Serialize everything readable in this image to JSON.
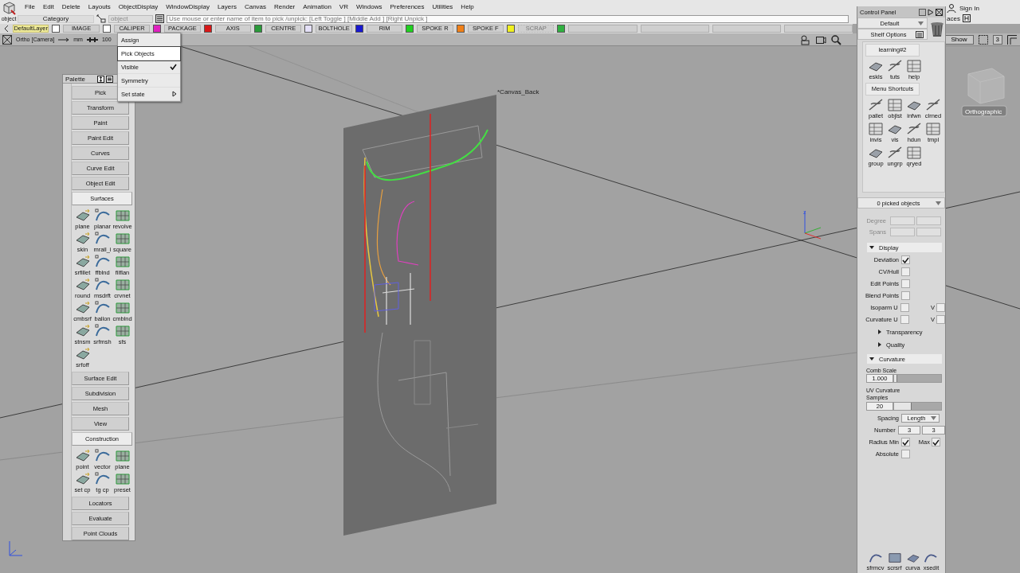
{
  "menu_bar": {
    "app_label": "object",
    "items": [
      "File",
      "Edit",
      "Delete",
      "Layouts",
      "ObjectDisplay",
      "WindowDisplay",
      "Layers",
      "Canvas",
      "Render",
      "Animation",
      "VR",
      "Windows",
      "Preferences",
      "Utilities",
      "Help"
    ],
    "sign_in": "Sign In",
    "shelf_fragment": "aces"
  },
  "pick_bar": {
    "category": "Category",
    "object_placeholder": "object",
    "prompt": "Use mouse or enter name of item to pick /unpick: [Left Toggle ] [Middle Add ] [Right Unpick ]"
  },
  "layers": [
    {
      "name": "DefaultLayer",
      "selected": true,
      "color": "#ffffff"
    },
    {
      "name": "IMAGE",
      "selected": false,
      "color": "#ffffff"
    },
    {
      "name": "CALIPER",
      "selected": false,
      "color": "#e020c0"
    },
    {
      "name": "PACKAGE",
      "selected": false,
      "color": "#d81818"
    },
    {
      "name": "AXIS",
      "selected": false,
      "color": "#2a9a3a"
    },
    {
      "name": "CENTRE",
      "selected": false,
      "color": "#e4e0f8"
    },
    {
      "name": "BOLTHOLE",
      "selected": false,
      "color": "#1818d0"
    },
    {
      "name": "RIM",
      "selected": false,
      "color": "#20d020"
    },
    {
      "name": "SPOKE R",
      "selected": false,
      "color": "#f08018"
    },
    {
      "name": "SPOKE F",
      "selected": false,
      "color": "#f0f020"
    },
    {
      "name": "SCRAP",
      "selected": false,
      "color": "#30b040"
    }
  ],
  "viewport_bar": {
    "camera": "Ortho [Camera]",
    "units": "mm",
    "zoom": "100",
    "show": "Show",
    "layout": "3"
  },
  "layer_menu": [
    {
      "label": "Assign",
      "selected": false,
      "checked": false,
      "submenu": false
    },
    {
      "label": "Pick Objects",
      "selected": true,
      "checked": false,
      "submenu": false
    },
    {
      "label": "Visible",
      "selected": false,
      "checked": true,
      "submenu": false
    },
    {
      "label": "Symmetry",
      "selected": false,
      "checked": false,
      "submenu": false
    },
    {
      "label": "Set state",
      "selected": false,
      "checked": false,
      "submenu": true
    }
  ],
  "viewport": {
    "canvas_label": "*Canvas_Back",
    "view_label": "Orthographic",
    "axis_label": "z"
  },
  "palette": {
    "title": "Palette",
    "sections": [
      {
        "label": "Pick",
        "expanded": false
      },
      {
        "label": "Transform",
        "expanded": false
      },
      {
        "label": "Paint",
        "expanded": false
      },
      {
        "label": "Paint Edit",
        "expanded": false
      },
      {
        "label": "Curves",
        "expanded": false
      },
      {
        "label": "Curve Edit",
        "expanded": false
      },
      {
        "label": "Object Edit",
        "expanded": false
      },
      {
        "label": "Surfaces",
        "expanded": true,
        "tools": [
          "plane",
          "planar",
          "revolve",
          "skin",
          "mrail_i",
          "square",
          "srfillet",
          "ffblnd",
          "filflan",
          "round",
          "msdrft",
          "crvnet",
          "cmbsrf",
          "ballon",
          "cmblnd",
          "stnsm",
          "srfmsh",
          "sfs",
          "srfoff"
        ]
      },
      {
        "label": "Surface Edit",
        "expanded": false
      },
      {
        "label": "Subdivision",
        "expanded": false
      },
      {
        "label": "Mesh",
        "expanded": false
      },
      {
        "label": "View",
        "expanded": false
      },
      {
        "label": "Construction",
        "expanded": true,
        "tools": [
          "point",
          "vector",
          "plane",
          "set cp",
          "tg cp",
          "preset"
        ]
      },
      {
        "label": "Locators",
        "expanded": false
      },
      {
        "label": "Evaluate",
        "expanded": false
      },
      {
        "label": "Point Clouds",
        "expanded": false
      }
    ]
  },
  "control_panel": {
    "title": "Control Panel",
    "preset": "Default",
    "shelf_options": "Shelf Options",
    "shelf_tabs": [
      {
        "label": "learning#2",
        "tools": [
          "eskls",
          "tuts",
          "help"
        ]
      },
      {
        "label": "Menu Shortcuts",
        "tools": [
          "pallet",
          "objlst",
          "infwn",
          "clrned",
          "invis",
          "vis",
          "hdun",
          "tmpl",
          "group",
          "ungrp",
          "qryed"
        ]
      }
    ],
    "picked": "0 picked objects",
    "degree_label": "Degree",
    "spans_label": "Spans",
    "display": {
      "label": "Display",
      "expanded": true,
      "options": [
        {
          "label": "Deviation",
          "checked": true
        },
        {
          "label": "CV/Hull",
          "checked": false
        },
        {
          "label": "Edit Points",
          "checked": false
        },
        {
          "label": "Blend Points",
          "checked": false
        },
        {
          "label": "Isoparm U",
          "checked": false,
          "v_label": "V",
          "v_checked": false
        },
        {
          "label": "Curvature U",
          "checked": false,
          "v_label": "V",
          "v_checked": false
        }
      ],
      "subsections": [
        {
          "label": "Transparency",
          "expanded": false
        },
        {
          "label": "Quality",
          "expanded": false
        }
      ]
    },
    "curvature": {
      "label": "Curvature",
      "expanded": true,
      "comb_scale": {
        "label": "Comb Scale",
        "value": "1.000",
        "level": 0.05
      },
      "samples": {
        "label": "UV Curvature Samples",
        "value": "20",
        "level": 0.35
      },
      "spacing": {
        "label": "Spacing",
        "value": "Length"
      },
      "number": {
        "label": "Number",
        "values": [
          "3",
          "3"
        ]
      },
      "radius": [
        {
          "label": "Radius Min",
          "checked": true
        },
        {
          "label": "Max",
          "checked": true
        }
      ],
      "absolute": {
        "label": "Absolute",
        "checked": false
      }
    },
    "bottom_shelf": [
      "sfrmcv",
      "scrsrf",
      "curva",
      "xsedit"
    ]
  }
}
